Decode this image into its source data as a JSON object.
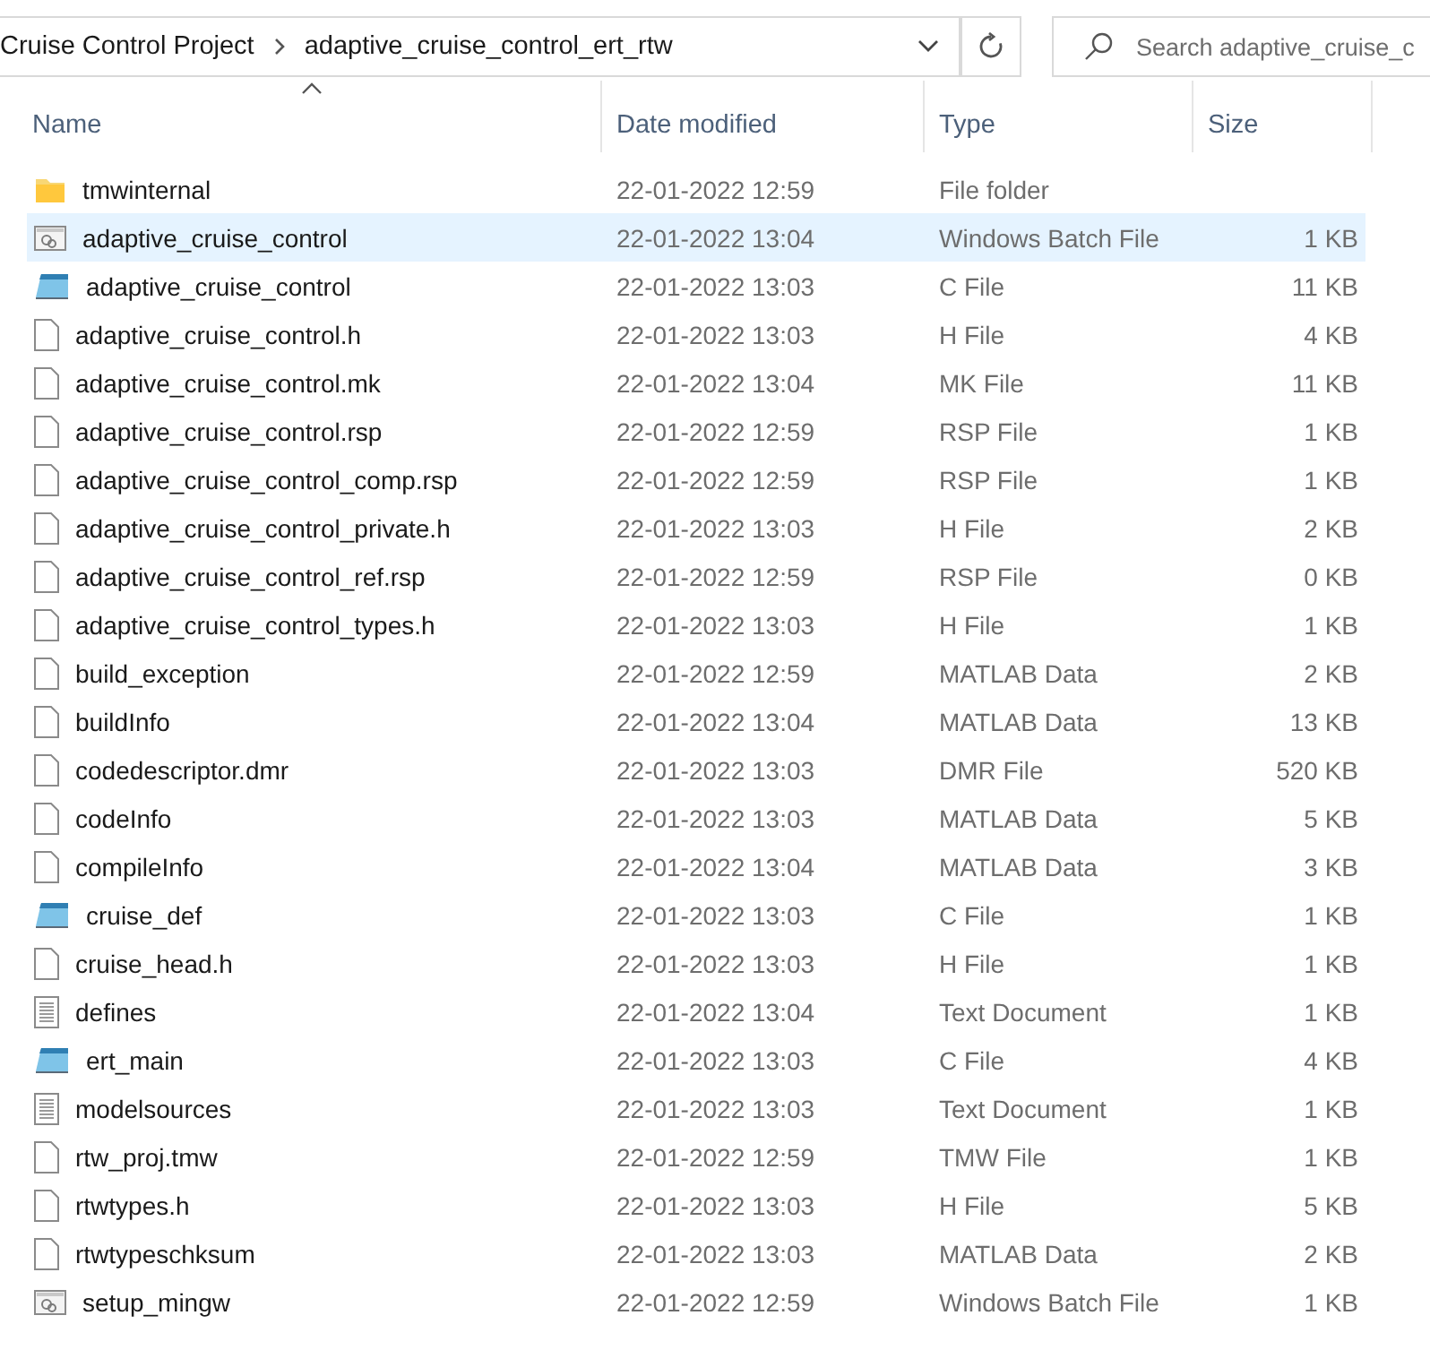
{
  "address_bar": {
    "path": [
      "Cruise Control Project",
      "adaptive_cruise_control_ert_rtw"
    ]
  },
  "search": {
    "placeholder": "Search adaptive_cruise_c"
  },
  "columns": [
    {
      "label": "Name",
      "sorted": true
    },
    {
      "label": "Date modified",
      "sorted": false
    },
    {
      "label": "Type",
      "sorted": false
    },
    {
      "label": "Size",
      "sorted": false
    }
  ],
  "rows": [
    {
      "kind": "folder",
      "name": "tmwinternal",
      "date": "22-01-2022 12:59",
      "type": "File folder",
      "selected": false
    },
    {
      "kind": "batch",
      "name": "adaptive_cruise_control",
      "date": "22-01-2022 13:04",
      "type": "Windows Batch File",
      "size": "1 KB",
      "selected": true
    },
    {
      "kind": "c",
      "name": "adaptive_cruise_control",
      "date": "22-01-2022 13:03",
      "type": "C File",
      "size": "11 KB",
      "selected": false
    },
    {
      "kind": "file",
      "name": "adaptive_cruise_control.h",
      "date": "22-01-2022 13:03",
      "type": "H File",
      "size": "4 KB",
      "selected": false
    },
    {
      "kind": "file",
      "name": "adaptive_cruise_control.mk",
      "date": "22-01-2022 13:04",
      "type": "MK File",
      "size": "11 KB",
      "selected": false
    },
    {
      "kind": "file",
      "name": "adaptive_cruise_control.rsp",
      "date": "22-01-2022 12:59",
      "type": "RSP File",
      "size": "1 KB",
      "selected": false
    },
    {
      "kind": "file",
      "name": "adaptive_cruise_control_comp.rsp",
      "date": "22-01-2022 12:59",
      "type": "RSP File",
      "size": "1 KB",
      "selected": false
    },
    {
      "kind": "file",
      "name": "adaptive_cruise_control_private.h",
      "date": "22-01-2022 13:03",
      "type": "H File",
      "size": "2 KB",
      "selected": false
    },
    {
      "kind": "file",
      "name": "adaptive_cruise_control_ref.rsp",
      "date": "22-01-2022 12:59",
      "type": "RSP File",
      "size": "0 KB",
      "selected": false
    },
    {
      "kind": "file",
      "name": "adaptive_cruise_control_types.h",
      "date": "22-01-2022 13:03",
      "type": "H File",
      "size": "1 KB",
      "selected": false
    },
    {
      "kind": "file",
      "name": "build_exception",
      "date": "22-01-2022 12:59",
      "type": "MATLAB Data",
      "size": "2 KB",
      "selected": false
    },
    {
      "kind": "file",
      "name": "buildInfo",
      "date": "22-01-2022 13:04",
      "type": "MATLAB Data",
      "size": "13 KB",
      "selected": false
    },
    {
      "kind": "file",
      "name": "codedescriptor.dmr",
      "date": "22-01-2022 13:03",
      "type": "DMR File",
      "size": "520 KB",
      "selected": false
    },
    {
      "kind": "file",
      "name": "codeInfo",
      "date": "22-01-2022 13:03",
      "type": "MATLAB Data",
      "size": "5 KB",
      "selected": false
    },
    {
      "kind": "file",
      "name": "compileInfo",
      "date": "22-01-2022 13:04",
      "type": "MATLAB Data",
      "size": "3 KB",
      "selected": false
    },
    {
      "kind": "c",
      "name": "cruise_def",
      "date": "22-01-2022 13:03",
      "type": "C File",
      "size": "1 KB",
      "selected": false
    },
    {
      "kind": "file",
      "name": "cruise_head.h",
      "date": "22-01-2022 13:03",
      "type": "H File",
      "size": "1 KB",
      "selected": false
    },
    {
      "kind": "text",
      "name": "defines",
      "date": "22-01-2022 13:04",
      "type": "Text Document",
      "size": "1 KB",
      "selected": false
    },
    {
      "kind": "c",
      "name": "ert_main",
      "date": "22-01-2022 13:03",
      "type": "C File",
      "size": "4 KB",
      "selected": false
    },
    {
      "kind": "text",
      "name": "modelsources",
      "date": "22-01-2022 13:03",
      "type": "Text Document",
      "size": "1 KB",
      "selected": false
    },
    {
      "kind": "file",
      "name": "rtw_proj.tmw",
      "date": "22-01-2022 12:59",
      "type": "TMW File",
      "size": "1 KB",
      "selected": false
    },
    {
      "kind": "file",
      "name": "rtwtypes.h",
      "date": "22-01-2022 13:03",
      "type": "H File",
      "size": "5 KB",
      "selected": false
    },
    {
      "kind": "file",
      "name": "rtwtypeschksum",
      "date": "22-01-2022 13:03",
      "type": "MATLAB Data",
      "size": "2 KB",
      "selected": false
    },
    {
      "kind": "batch",
      "name": "setup_mingw",
      "date": "22-01-2022 12:59",
      "type": "Windows Batch File",
      "size": "1 KB",
      "selected": false
    }
  ]
}
